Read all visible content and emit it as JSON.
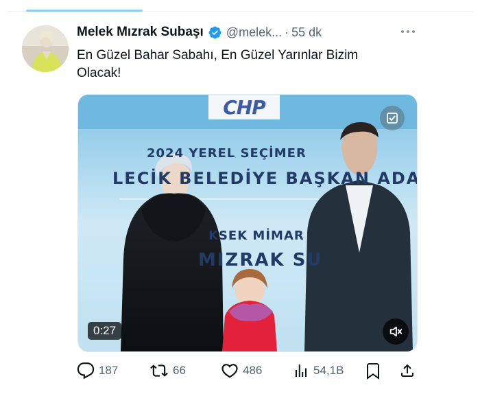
{
  "tweet": {
    "author": {
      "display_name": "Melek Mızrak Subaşı",
      "verified": true,
      "handle": "@melek...",
      "time": "55 dk"
    },
    "text_line1": "En Güzel Bahar Sabahı, En Güzel Yarınlar Bizim",
    "text_line2": "Olacak!",
    "media": {
      "type": "video",
      "duration": "0:27",
      "banner": {
        "logo": "CHP",
        "line1": "2024 YEREL SEÇİMER",
        "line2": "LECİK BELEDİYE BAŞKAN ADAY",
        "line3": "KSEK MİMAR",
        "line4": "MIZRAK SU"
      }
    },
    "metrics": {
      "replies": "187",
      "reposts": "66",
      "likes": "486",
      "views": "54,1B"
    }
  },
  "icons": {
    "more": "more-horizontal-icon",
    "verified": "verified-badge-icon",
    "reply": "reply-icon",
    "repost": "repost-icon",
    "like": "heart-icon",
    "views": "views-chart-icon",
    "bookmark": "bookmark-icon",
    "share": "share-icon",
    "mute": "muted-speaker-icon"
  },
  "colors": {
    "verified_blue": "#1d9bf0",
    "text_primary": "#0f1419",
    "text_secondary": "#536471",
    "banner_blue": "#213a66"
  }
}
